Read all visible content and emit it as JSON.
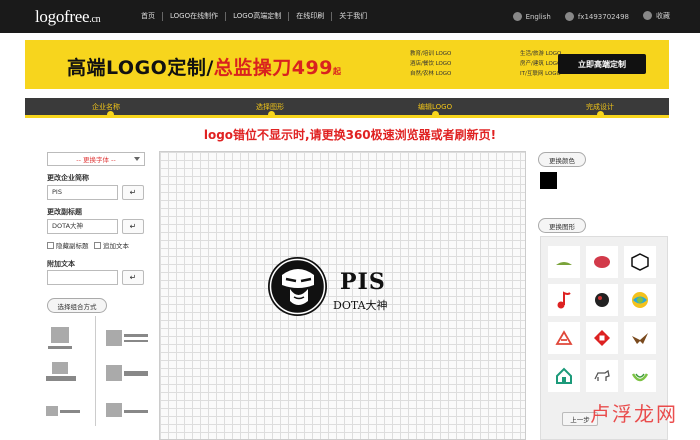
{
  "nav": {
    "logo_main": "logofree",
    "logo_suffix": ".cn",
    "links": [
      "首页",
      "LOGO在线制作",
      "LOGO高端定制",
      "在线印刷",
      "关于我们"
    ],
    "language": "English",
    "user": "fx1493702498",
    "favorite": "收藏"
  },
  "banner": {
    "title_black": "高端LOGO定制/",
    "title_red": "总监操刀499",
    "title_unit": "起",
    "features": [
      "教育/培训 LOGO",
      "生活/旅游 LOGO",
      "酒店/餐饮 LOGO",
      "房产/建筑 LOGO",
      "自然/农林 LOGO",
      "IT/互联网 LOGO"
    ],
    "cta": "立即高端定制",
    "bg": "#f7d51d",
    "accent": "#d9221f"
  },
  "steps": [
    "企业名称",
    "选择图形",
    "编辑LOGO",
    "完成设计"
  ],
  "warning": "logo错位不显示时,请更换360极速浏览器或者刷新页!",
  "editor": {
    "font_select": "-- 更换字体 --",
    "company_label": "更改企业简称",
    "company_value": "PIS",
    "subtitle_label": "更改副标题",
    "subtitle_value": "DOTA大神",
    "hide_subtitle": "隐藏副标题",
    "add_text": "追加文本",
    "extra_label": "附加文本",
    "extra_value": "",
    "apply": "↵",
    "combo_button": "选择组合方式"
  },
  "canvas": {
    "brand": "PIS",
    "subtitle": "DOTA大神"
  },
  "right": {
    "change_color": "更换颜色",
    "current_color": "#000000",
    "change_shape": "更换图形",
    "shape_icons": [
      "bird-logo",
      "lips-logo",
      "badge-logo",
      "music-note-logo",
      "dark-orb-logo",
      "colorful-leaf-logo",
      "abstract-a-logo",
      "red-diamond-logo",
      "eagle-logo",
      "house-logo",
      "dog-logo",
      "green-bowl-logo"
    ],
    "prev": "上一步"
  },
  "watermark": "卢浮龙网"
}
